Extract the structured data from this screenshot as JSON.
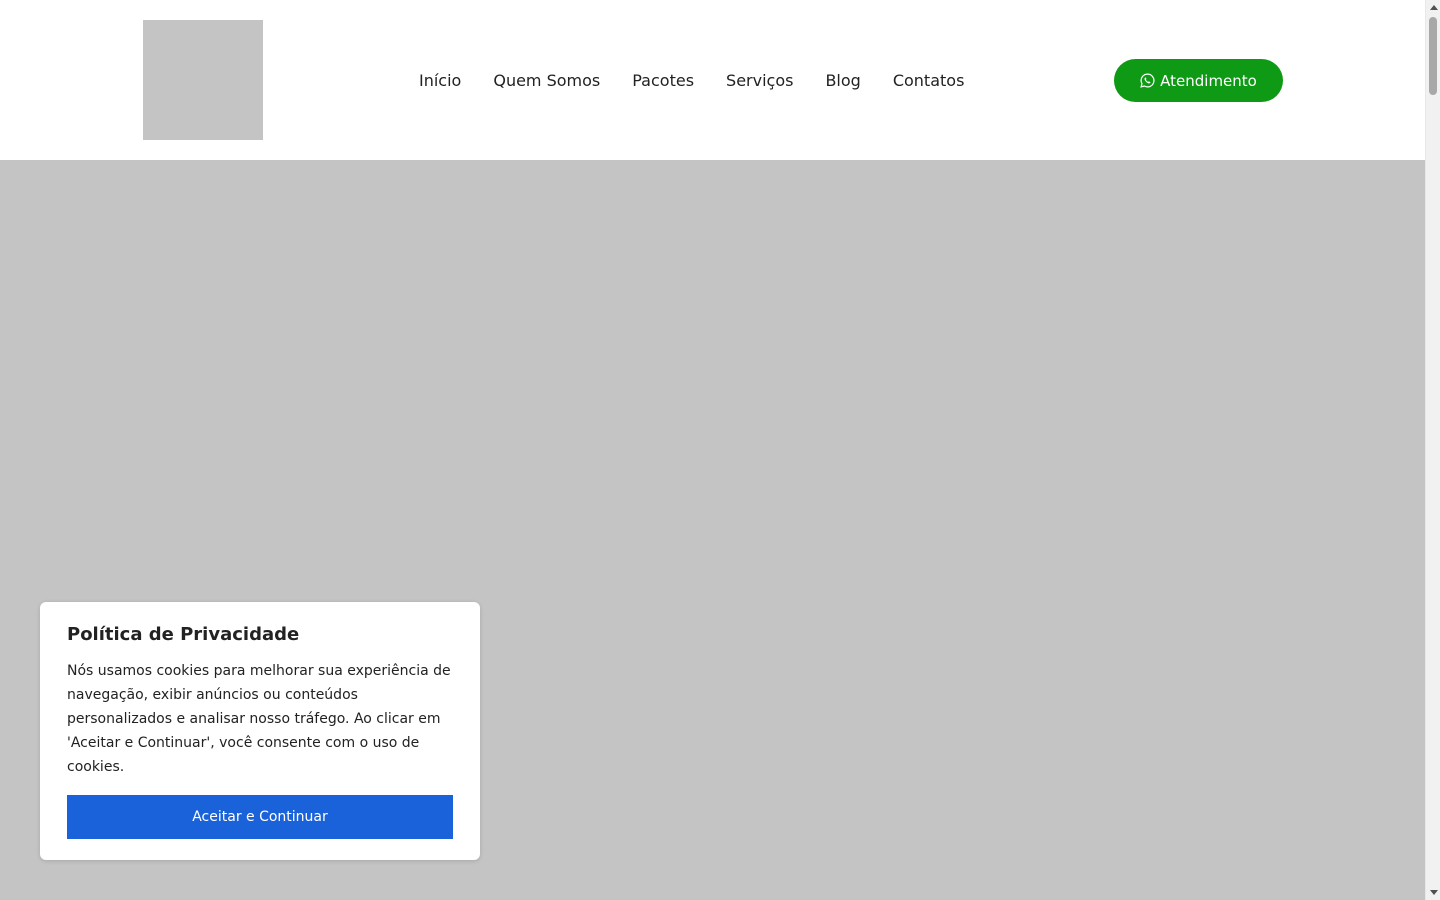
{
  "header": {
    "nav": [
      {
        "label": "Início"
      },
      {
        "label": "Quem Somos"
      },
      {
        "label": "Pacotes"
      },
      {
        "label": "Serviços"
      },
      {
        "label": "Blog"
      },
      {
        "label": "Contatos"
      }
    ],
    "cta": {
      "label": "Atendimento",
      "icon": "whatsapp-icon",
      "color": "#0e9a14"
    }
  },
  "cookie_banner": {
    "title": "Política de Privacidade",
    "text": "Nós usamos cookies para melhorar sua experiência de navegação, exibir anúncios ou conteúdos personalizados e analisar nosso tráfego. Ao clicar em 'Aceitar e Continuar', você consente com o uso de cookies.",
    "button_label": "Aceitar e Continuar",
    "button_color": "#1a62da"
  },
  "colors": {
    "placeholder": "#c4c4c4"
  }
}
